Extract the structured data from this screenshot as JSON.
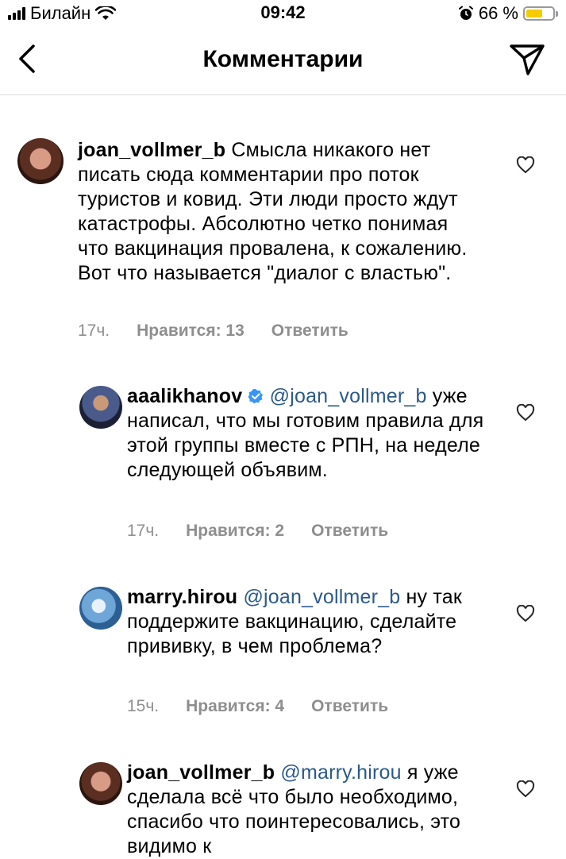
{
  "status_bar": {
    "carrier": "Билайн",
    "time": "09:42",
    "battery_percent": "66 %",
    "battery_level": 0.66
  },
  "nav": {
    "title": "Комментарии",
    "back_icon": "chevron-left-icon",
    "send_icon": "paper-plane-icon"
  },
  "comments": [
    {
      "username": "joan_vollmer_b",
      "verified": false,
      "text": "Смысла никакого нет писать сюда комментарии про поток туристов и ковид. Эти люди просто ждут катастрофы. Абсолютно четко понимая что вакцинация провалена, к сожалению. Вот что называется \"диалог с властью\".",
      "time": "17ч.",
      "likes": "Нравится: 13",
      "reply": "Ответить"
    },
    {
      "username": "aaalikhanov",
      "verified": true,
      "mention": "@joan_vollmer_b",
      "text": "уже написал, что мы готовим правила для этой группы вместе с РПН, на неделе следующей объявим.",
      "time": "17ч.",
      "likes": "Нравится: 2",
      "reply": "Ответить"
    },
    {
      "username": "marry.hirou",
      "verified": false,
      "mention": "@joan_vollmer_b",
      "text": "ну так поддержите вакцинацию, сделайте прививку, в чем проблема?",
      "time": "15ч.",
      "likes": "Нравится: 4",
      "reply": "Ответить"
    },
    {
      "username": "joan_vollmer_b",
      "verified": false,
      "mention": "@marry.hirou",
      "text": "я уже сделала всё что было необходимо, спасибо что поинтересовались, это видимо к"
    }
  ],
  "colors": {
    "mention": "#2b5a8a",
    "meta": "#8e8e8e",
    "divider": "#dbdbdb",
    "battery": "#f5cc00"
  }
}
